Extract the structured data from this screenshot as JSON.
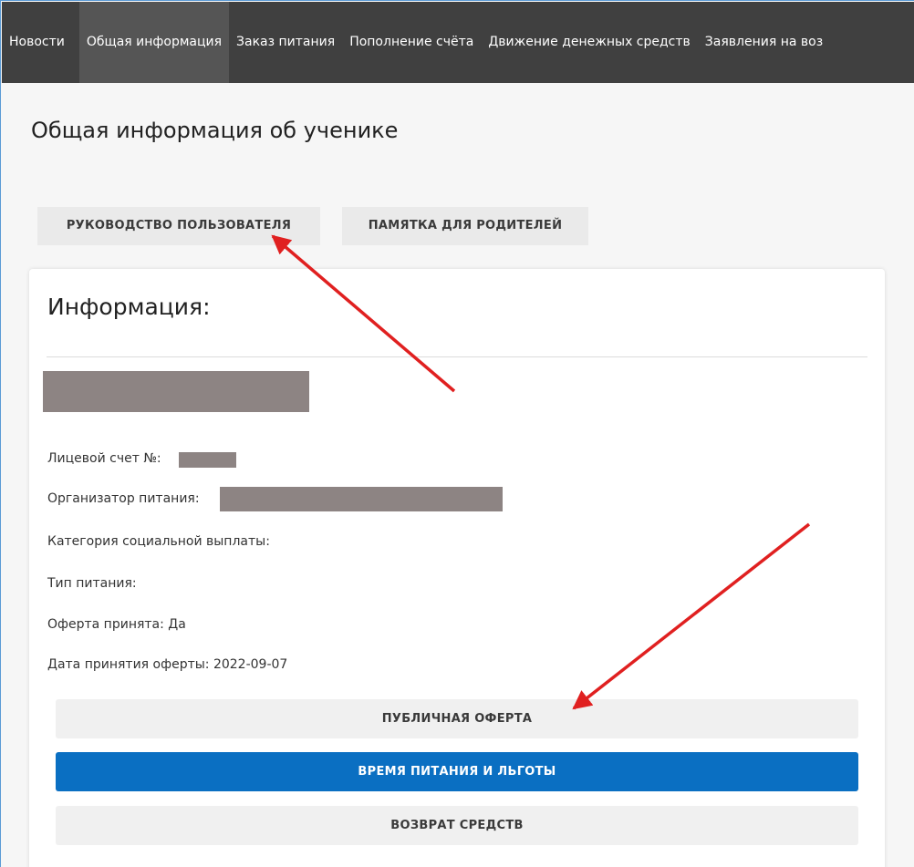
{
  "nav": {
    "items": [
      {
        "label": "Новости",
        "active": false
      },
      {
        "label": "Общая информация",
        "active": true
      },
      {
        "label": "Заказ питания",
        "active": false
      },
      {
        "label": "Пополнение счёта",
        "active": false
      },
      {
        "label": "Движение денежных средств",
        "active": false
      },
      {
        "label": "Заявления на воз",
        "active": false
      }
    ]
  },
  "page": {
    "title": "Общая информация об ученике"
  },
  "guides": {
    "user_manual": "РУКОВОДСТВО ПОЛЬЗОВАТЕЛЯ",
    "parents_memo": "ПАМЯТКА ДЛЯ РОДИТЕЛЕЙ"
  },
  "info": {
    "title": "Информация:",
    "account_label": "Лицевой счет №:",
    "organizer_label": "Организатор питания:",
    "social_category_label": "Категория социальной выплаты:",
    "meal_type_label": "Тип питания:",
    "offer_accepted_label": "Оферта принята: Да",
    "offer_date_label": "Дата принятия оферты: 2022-09-07"
  },
  "actions": {
    "public_offer": "ПУБЛИЧНАЯ ОФЕРТА",
    "meal_time_benefits": "ВРЕМЯ ПИТАНИЯ И ЛЬГОТЫ",
    "refund": "ВОЗВРАТ СРЕДСТВ"
  },
  "colors": {
    "nav_bg": "#404040",
    "nav_active_bg": "#555555",
    "primary_button": "#0a6fc2",
    "redaction": "#8d8483",
    "annotation_arrow": "#e02020"
  }
}
